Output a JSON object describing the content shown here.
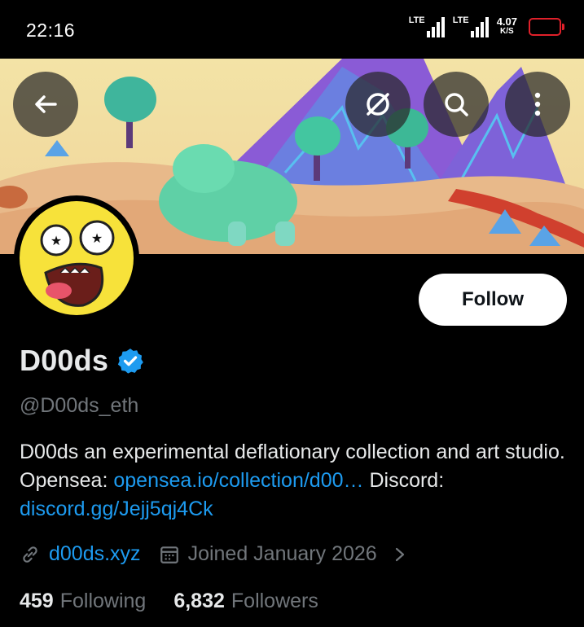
{
  "status_bar": {
    "time": "22:16",
    "sim1": "LTE",
    "sim2": "LTE",
    "net_speed_value": "4.07",
    "net_speed_unit": "K/S",
    "battery_color": "#e0202a"
  },
  "header": {
    "back_icon": "arrow-left-icon",
    "grok_icon": "slashed-circle-icon",
    "search_icon": "search-icon",
    "more_icon": "more-vertical-icon"
  },
  "profile": {
    "display_name": "D00ds",
    "verified": true,
    "handle": "@D00ds_eth",
    "follow_label": "Follow",
    "bio_text_1": "D00ds an experimental deflationary collection and art studio.  Opensea: ",
    "bio_link_1": "opensea.io/collection/d00…",
    "bio_text_2": " Discord: ",
    "bio_link_2": "discord.gg/Jejj5qj4Ck",
    "website": "d00ds.xyz",
    "joined": "Joined January 2026",
    "following_count": "459",
    "following_label": "Following",
    "followers_count": "6,832",
    "followers_label": "Followers"
  },
  "colors": {
    "accent": "#1d9bf0",
    "muted": "#71767b",
    "text": "#e7e9ea"
  }
}
